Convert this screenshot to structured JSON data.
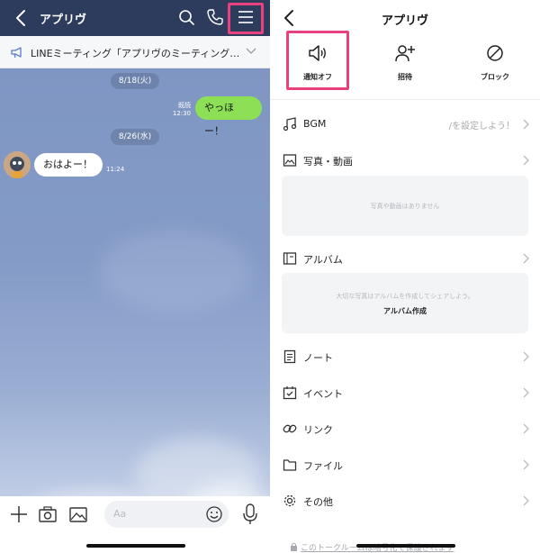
{
  "chat": {
    "title": "アプリヴ",
    "notice": "LINEミーティング「アプリヴのミーティング…",
    "dates": [
      "8/18(火)",
      "8/26(水)"
    ],
    "sent": {
      "text": "やっほー！",
      "read": "既読",
      "time": "12:30"
    },
    "received": {
      "text": "おはよー！",
      "time": "11:24"
    },
    "input_placeholder": "Aa"
  },
  "settings": {
    "title": "アプリヴ",
    "actions": [
      {
        "label": "通知オフ",
        "icon": "speaker-icon"
      },
      {
        "label": "招待",
        "icon": "add-person-icon"
      },
      {
        "label": "ブロック",
        "icon": "block-icon"
      }
    ],
    "rows": {
      "bgm": {
        "label": "BGM",
        "value": "/を設定しよう！"
      },
      "photos": {
        "label": "写真・動画",
        "empty": "写真や動画はありません"
      },
      "album": {
        "label": "アルバム",
        "empty": "大切な写真はアルバムを作成してシェアしよう。",
        "button": "アルバム作成"
      },
      "note": {
        "label": "ノート"
      },
      "event": {
        "label": "イベント"
      },
      "link": {
        "label": "リンク"
      },
      "file": {
        "label": "ファイル"
      },
      "other": {
        "label": "その他"
      }
    },
    "footer": "このトークルームは暗号化で保護されます"
  },
  "colors": {
    "highlight": "#e8417d",
    "header": "#2d3c5c",
    "bubble_green": "#8de055",
    "chat_bg": "#7f96c3"
  }
}
